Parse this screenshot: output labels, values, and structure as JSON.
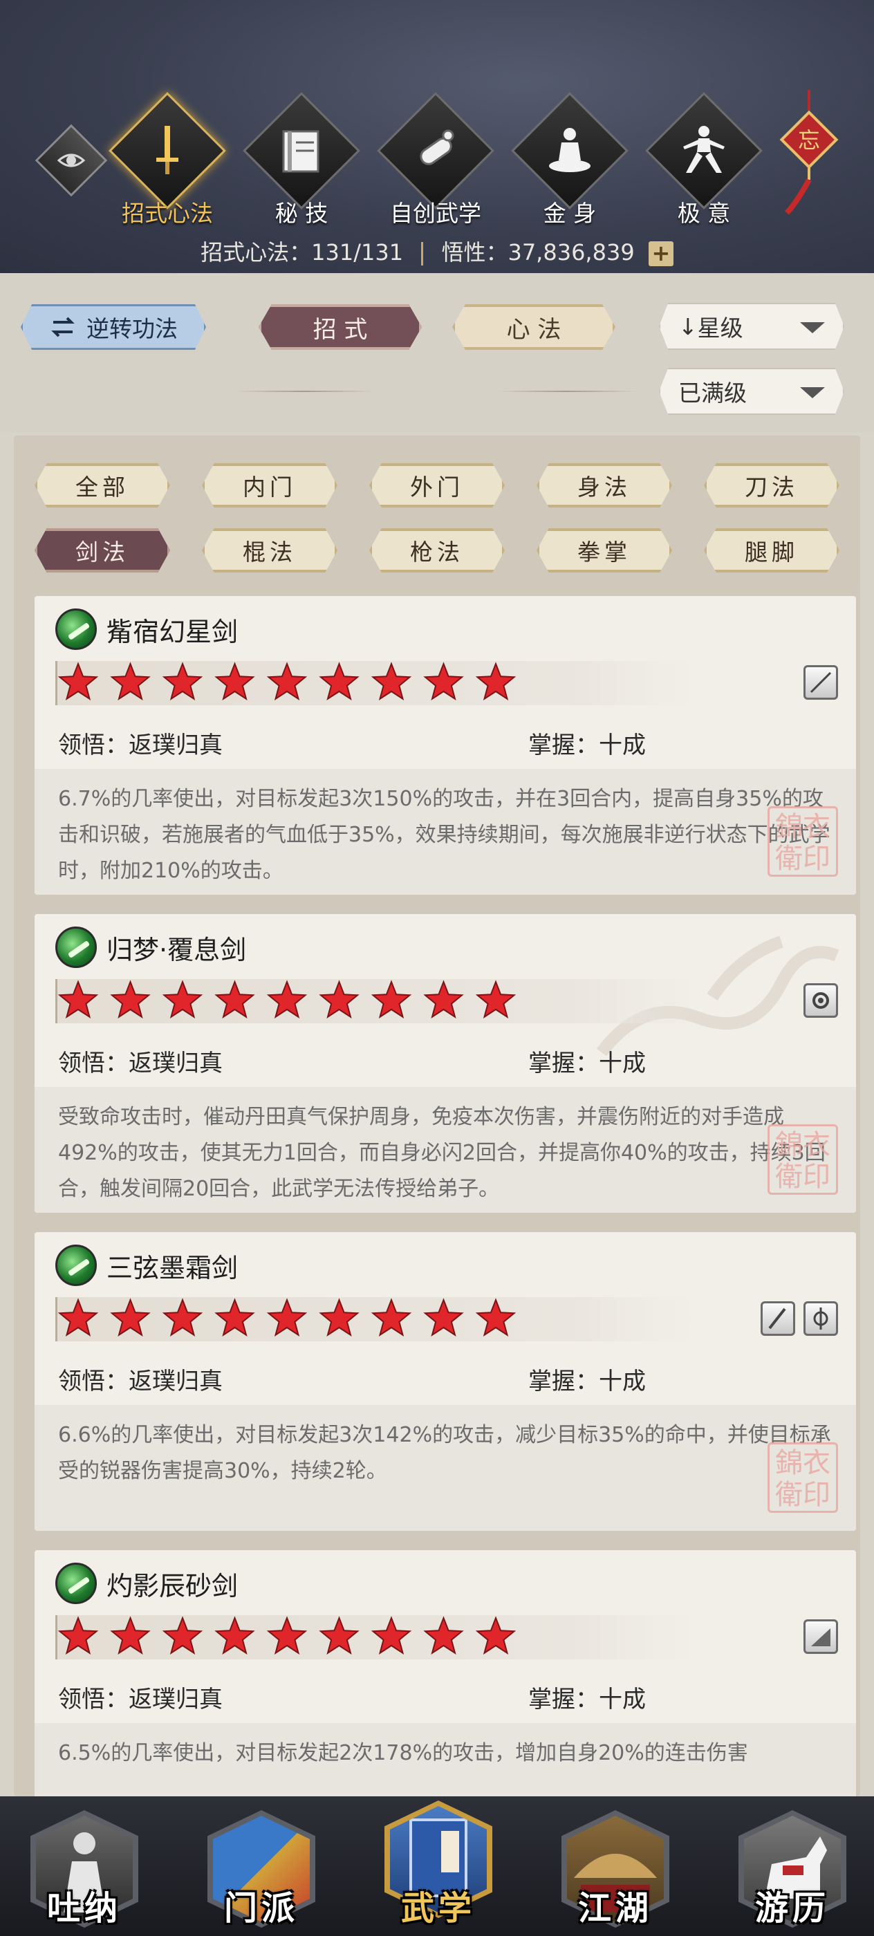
{
  "header": {
    "categories": [
      {
        "label": "招式心法",
        "icon": "sword-icon",
        "active": true
      },
      {
        "label": "秘 技",
        "icon": "book-icon",
        "active": false
      },
      {
        "label": "自创武学",
        "icon": "scroll-icon",
        "active": false
      },
      {
        "label": "金 身",
        "icon": "meditation-icon",
        "active": false
      },
      {
        "label": "极 意",
        "icon": "martial-pose-icon",
        "active": false
      }
    ],
    "knot_char": "忘",
    "stats": {
      "label1": "招式心法：",
      "value1": "131/131",
      "label2": "悟性：",
      "value2": "37,836,839",
      "plus": "+"
    }
  },
  "filter_bar": {
    "reverse_button": "逆转功法",
    "tabs": [
      {
        "label": "招 式",
        "active": true
      },
      {
        "label": "心 法",
        "active": false
      }
    ],
    "sort_dropdown": "星级",
    "sort_arrow": "↓",
    "level_dropdown": "已满级"
  },
  "chips": [
    {
      "label": "全部",
      "active": false
    },
    {
      "label": "内门",
      "active": false
    },
    {
      "label": "外门",
      "active": false
    },
    {
      "label": "身法",
      "active": false
    },
    {
      "label": "刀法",
      "active": false
    },
    {
      "label": "剑法",
      "active": true
    },
    {
      "label": "棍法",
      "active": false
    },
    {
      "label": "枪法",
      "active": false
    },
    {
      "label": "拳掌",
      "active": false
    },
    {
      "label": "腿脚",
      "active": false
    }
  ],
  "skills": [
    {
      "name": "觜宿幻星剑",
      "stars": 9,
      "comprehension_label": "领悟：",
      "comprehension": "返璞归真",
      "mastery_label": "掌握：",
      "mastery": "十成",
      "description": "6.7%的几率使出，对目标发起3次150%的攻击，并在3回合内，提高自身35%的攻击和识破，若施展者的气血低于35%，效果持续期间，每次施展非逆行状态下的武学时，附加210%的攻击。",
      "icons": [
        "slash-icon"
      ]
    },
    {
      "name": "归梦·覆息剑",
      "stars": 9,
      "comprehension_label": "领悟：",
      "comprehension": "返璞归真",
      "mastery_label": "掌握：",
      "mastery": "十成",
      "description": "受致命攻击时，催动丹田真气保护周身，免疫本次伤害，并震伤附近的对手造成492%的攻击，使其无力1回合，而自身必闪2回合，并提高你40%的攻击，持续3回合，触发间隔20回合，此武学无法传授给弟子。",
      "icons": [
        "gear-icon"
      ]
    },
    {
      "name": "三弦墨霜剑",
      "stars": 9,
      "comprehension_label": "领悟：",
      "comprehension": "返璞归真",
      "mastery_label": "掌握：",
      "mastery": "十成",
      "description": "6.6%的几率使出，对目标发起3次142%的攻击，减少目标35%的命中，并使目标承受的锐器伤害提高30%，持续2轮。",
      "icons": [
        "blade-icon",
        "phi-icon"
      ]
    },
    {
      "name": "灼影辰砂剑",
      "stars": 9,
      "comprehension_label": "领悟：",
      "comprehension": "返璞归真",
      "mastery_label": "掌握：",
      "mastery": "十成",
      "description": "6.5%的几率使出，对目标发起2次178%的攻击，增加自身20%的连击伤害",
      "icons": [
        "sword-slash-icon"
      ]
    }
  ],
  "seal_text": "锦衣\n卫印",
  "bottom_nav": [
    {
      "label": "吐纳",
      "icon": "breathing-figure-icon",
      "active": false
    },
    {
      "label": "门派",
      "icon": "sect-banner-icon",
      "active": false
    },
    {
      "label": "武学",
      "icon": "martial-book-icon",
      "active": true
    },
    {
      "label": "江湖",
      "icon": "straw-hat-icon",
      "active": false
    },
    {
      "label": "游历",
      "icon": "horse-icon",
      "active": false
    }
  ]
}
